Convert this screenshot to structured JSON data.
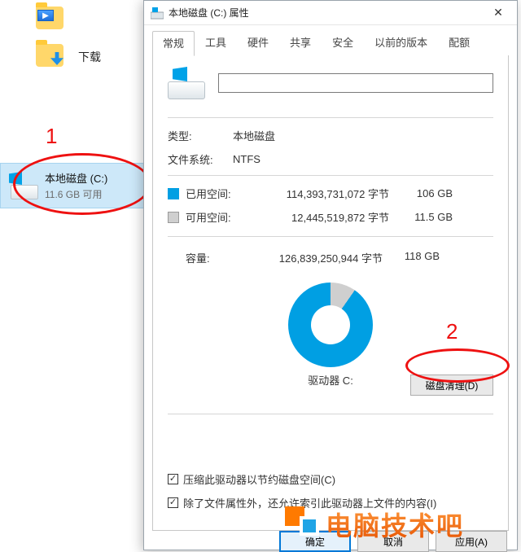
{
  "explorer": {
    "folders": [
      {
        "label": ""
      },
      {
        "label": "下载"
      }
    ],
    "drive": {
      "title": "本地磁盘 (C:)",
      "subtitle": "11.6 GB 可用"
    }
  },
  "annotations": {
    "label1": "1",
    "label2": "2"
  },
  "dialog": {
    "title": "本地磁盘 (C:) 属性",
    "tabs": [
      "常规",
      "工具",
      "硬件",
      "共享",
      "安全",
      "以前的版本",
      "配额"
    ],
    "active_tab_index": 0,
    "name_value": "",
    "type_label": "类型:",
    "type_value": "本地磁盘",
    "fs_label": "文件系统:",
    "fs_value": "NTFS",
    "used_label": "已用空间:",
    "used_bytes": "114,393,731,072 字节",
    "used_gb": "106 GB",
    "free_label": "可用空间:",
    "free_bytes": "12,445,519,872 字节",
    "free_gb": "11.5 GB",
    "cap_label": "容量:",
    "cap_bytes": "126,839,250,944 字节",
    "cap_gb": "118 GB",
    "drive_caption": "驱动器 C:",
    "cleanup_button": "磁盘清理(D)",
    "chk1": "压缩此驱动器以节约磁盘空间(C)",
    "chk2": "除了文件属性外，还允许索引此驱动器上文件的内容(I)",
    "chk1_checked": true,
    "chk2_checked": true,
    "ok": "确定",
    "cancel": "取消",
    "apply": "应用(A)"
  },
  "watermark": {
    "text": "电脑技术吧"
  },
  "chart_data": {
    "type": "pie",
    "title": "驱动器 C:",
    "series": [
      {
        "name": "已用空间",
        "value": 114393731072,
        "display": "106 GB",
        "color": "#009fe3"
      },
      {
        "name": "可用空间",
        "value": 12445519872,
        "display": "11.5 GB",
        "color": "#cfcfcf"
      }
    ],
    "total": {
      "name": "容量",
      "value": 126839250944,
      "display": "118 GB"
    }
  }
}
